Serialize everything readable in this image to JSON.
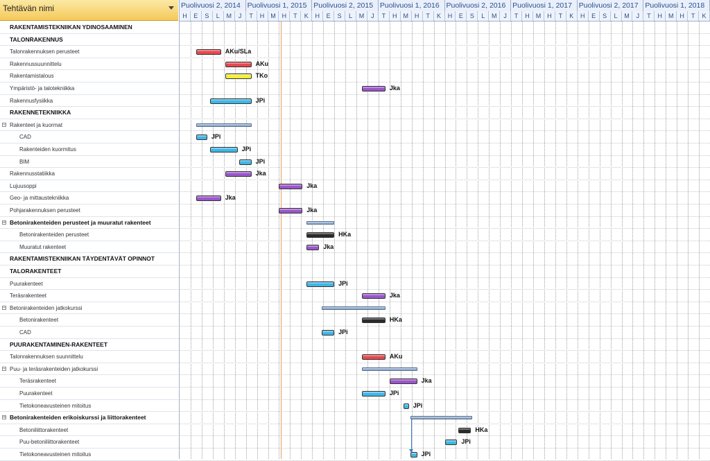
{
  "left_header": {
    "title": "Tehtävän nimi"
  },
  "semesters": [
    "Puolivuosi 2, 2014",
    "Puolivuosi 1, 2015",
    "Puolivuosi 2, 2015",
    "Puolivuosi 1, 2016",
    "Puolivuosi 2, 2016",
    "Puolivuosi 1, 2017",
    "Puolivuosi 2, 2017",
    "Puolivuosi 1, 2018"
  ],
  "months": [
    "H",
    "E",
    "S",
    "L",
    "M",
    "J",
    "T",
    "H",
    "M",
    "H",
    "T",
    "K",
    "H",
    "E",
    "S",
    "L",
    "M",
    "J",
    "T",
    "H",
    "M",
    "H",
    "T",
    "K",
    "H",
    "E",
    "S",
    "L",
    "M",
    "J",
    "T",
    "H",
    "M",
    "H",
    "T",
    "K",
    "H",
    "E",
    "S",
    "L",
    "M",
    "J",
    "T",
    "H",
    "M",
    "H",
    "T",
    "K"
  ],
  "colors": {
    "red": "#e8474f",
    "yellow": "#f2ee3a",
    "purple": "#9b55cc",
    "cyan": "#3fb6e6",
    "black": "#2a2a2a"
  },
  "tasks": [
    {
      "name": "RAKENTAMISTEKNIIKAN YDINOSAAMINEN",
      "level": 0,
      "bold": true
    },
    {
      "name": "TALONRAKENNUS",
      "level": 0,
      "bold": true
    },
    {
      "name": "Talonrakennuksen perusteet",
      "level": 0,
      "bold": false,
      "bar": {
        "color": "red",
        "start": 6,
        "end": 15
      },
      "label": "AKu/SLa"
    },
    {
      "name": "Rakennussuunnittelu",
      "level": 0,
      "bold": false,
      "bar": {
        "color": "red",
        "start": 16.5,
        "end": 26
      },
      "label": "AKu"
    },
    {
      "name": "Rakentamistalous",
      "level": 0,
      "bold": false,
      "bar": {
        "color": "yellow",
        "start": 16.5,
        "end": 26
      },
      "label": "TKo"
    },
    {
      "name": "Ympäristö- ja talotekniikka",
      "level": 0,
      "bold": false,
      "bar": {
        "color": "purple",
        "start": 66,
        "end": 74.5
      },
      "label": "Jka"
    },
    {
      "name": "Rakennusfysiikka",
      "level": 0,
      "bold": false,
      "bar": {
        "color": "cyan",
        "start": 11,
        "end": 26
      },
      "label": "JPi"
    },
    {
      "name": "RAKENNETEKNIIKKA",
      "level": 0,
      "bold": true
    },
    {
      "name": "Rakenteet ja kuormat",
      "level": 0,
      "bold": false,
      "collapse": true,
      "summary": {
        "start": 6,
        "end": 26
      }
    },
    {
      "name": "CAD",
      "level": 1,
      "bold": false,
      "bar": {
        "color": "cyan",
        "start": 6,
        "end": 10
      },
      "label": "JPi"
    },
    {
      "name": "Rakenteiden kuormitus",
      "level": 1,
      "bold": false,
      "bar": {
        "color": "cyan",
        "start": 11,
        "end": 21
      },
      "label": "JPi"
    },
    {
      "name": "BIM",
      "level": 1,
      "bold": false,
      "bar": {
        "color": "cyan",
        "start": 21.5,
        "end": 26
      },
      "label": "JPi"
    },
    {
      "name": "Rakennusstatiikka",
      "level": 0,
      "bold": false,
      "bar": {
        "color": "purple",
        "start": 16.5,
        "end": 26
      },
      "label": "Jka"
    },
    {
      "name": "Lujuusoppi",
      "level": 0,
      "bold": false,
      "bar": {
        "color": "purple",
        "start": 36,
        "end": 44.5
      },
      "label": "Jka"
    },
    {
      "name": "Geo- ja mittaustekniikka",
      "level": 0,
      "bold": false,
      "bar": {
        "color": "purple",
        "start": 6,
        "end": 15
      },
      "label": "Jka"
    },
    {
      "name": "Pohjarakennuksen perusteet",
      "level": 0,
      "bold": false,
      "bar": {
        "color": "purple",
        "start": 36,
        "end": 44.5
      },
      "label": "Jka"
    },
    {
      "name": "Betonirakenteiden perusteet ja muuratut rakenteet",
      "level": 0,
      "bold": true,
      "collapse": true,
      "summary": {
        "start": 46,
        "end": 56
      }
    },
    {
      "name": "Betonirakenteiden perusteet",
      "level": 1,
      "bold": false,
      "bar": {
        "color": "black",
        "start": 46,
        "end": 56
      },
      "label": "HKa"
    },
    {
      "name": "Muuratut rakenteet",
      "level": 1,
      "bold": false,
      "bar": {
        "color": "purple",
        "start": 46,
        "end": 50.5
      },
      "label": "Jka"
    },
    {
      "name": "RAKENTAMISTEKNIIKAN TÄYDENTÄVÄT OPINNOT",
      "level": 0,
      "bold": true
    },
    {
      "name": "TALORAKENTEET",
      "level": 0,
      "bold": true
    },
    {
      "name": "Puurakenteet",
      "level": 0,
      "bold": false,
      "bar": {
        "color": "cyan",
        "start": 46,
        "end": 56
      },
      "label": "JPi"
    },
    {
      "name": "Teräsrakenteet",
      "level": 0,
      "bold": false,
      "bar": {
        "color": "purple",
        "start": 66,
        "end": 74.5
      },
      "label": "Jka"
    },
    {
      "name": "Betonirakenteiden jatkokurssi",
      "level": 0,
      "bold": false,
      "collapse": true,
      "summary": {
        "start": 51.5,
        "end": 74.5
      }
    },
    {
      "name": "Betonirakenteet",
      "level": 1,
      "bold": false,
      "bar": {
        "color": "black",
        "start": 66,
        "end": 74.5
      },
      "label": "HKa"
    },
    {
      "name": "CAD",
      "level": 1,
      "bold": false,
      "bar": {
        "color": "cyan",
        "start": 51.5,
        "end": 56
      },
      "label": "JPi"
    },
    {
      "name": "PUURAKENTAMINEN-RAKENTEET",
      "level": 0,
      "bold": true
    },
    {
      "name": "Talonrakennuksen suunnittelu",
      "level": 0,
      "bold": false,
      "bar": {
        "color": "red",
        "start": 66,
        "end": 74.5
      },
      "label": "AKu"
    },
    {
      "name": "Puu- ja teräsrakenteiden jatkokurssi",
      "level": 0,
      "bold": false,
      "collapse": true,
      "summary": {
        "start": 66,
        "end": 86
      }
    },
    {
      "name": "Teräsrakenteet",
      "level": 1,
      "bold": false,
      "bar": {
        "color": "purple",
        "start": 76,
        "end": 86
      },
      "label": "Jka"
    },
    {
      "name": "Puurakenteet",
      "level": 1,
      "bold": false,
      "bar": {
        "color": "cyan",
        "start": 66,
        "end": 74.5
      },
      "label": "JPi"
    },
    {
      "name": "Tietokoneavusteinen mitoitus",
      "level": 1,
      "bold": false,
      "bar": {
        "color": "cyan",
        "start": 81,
        "end": 83
      },
      "label": "JPi"
    },
    {
      "name": "Betonirakenteiden erikoiskurssi ja liittorakenteet",
      "level": 0,
      "bold": true,
      "collapse": true,
      "summary": {
        "start": 83.5,
        "end": 106
      }
    },
    {
      "name": "Betoniliittorakenteet",
      "level": 1,
      "bold": false,
      "bar": {
        "color": "black",
        "start": 101,
        "end": 105.5
      },
      "label": "HKa"
    },
    {
      "name": "Puu-betoniliittorakenteet",
      "level": 1,
      "bold": false,
      "bar": {
        "color": "cyan",
        "start": 96,
        "end": 100.5
      },
      "label": "JPi"
    },
    {
      "name": "Tietokoneavusteinen mitoitus",
      "level": 1,
      "bold": false,
      "bar": {
        "color": "cyan",
        "start": 83.5,
        "end": 86
      },
      "label": "JPi"
    }
  ]
}
